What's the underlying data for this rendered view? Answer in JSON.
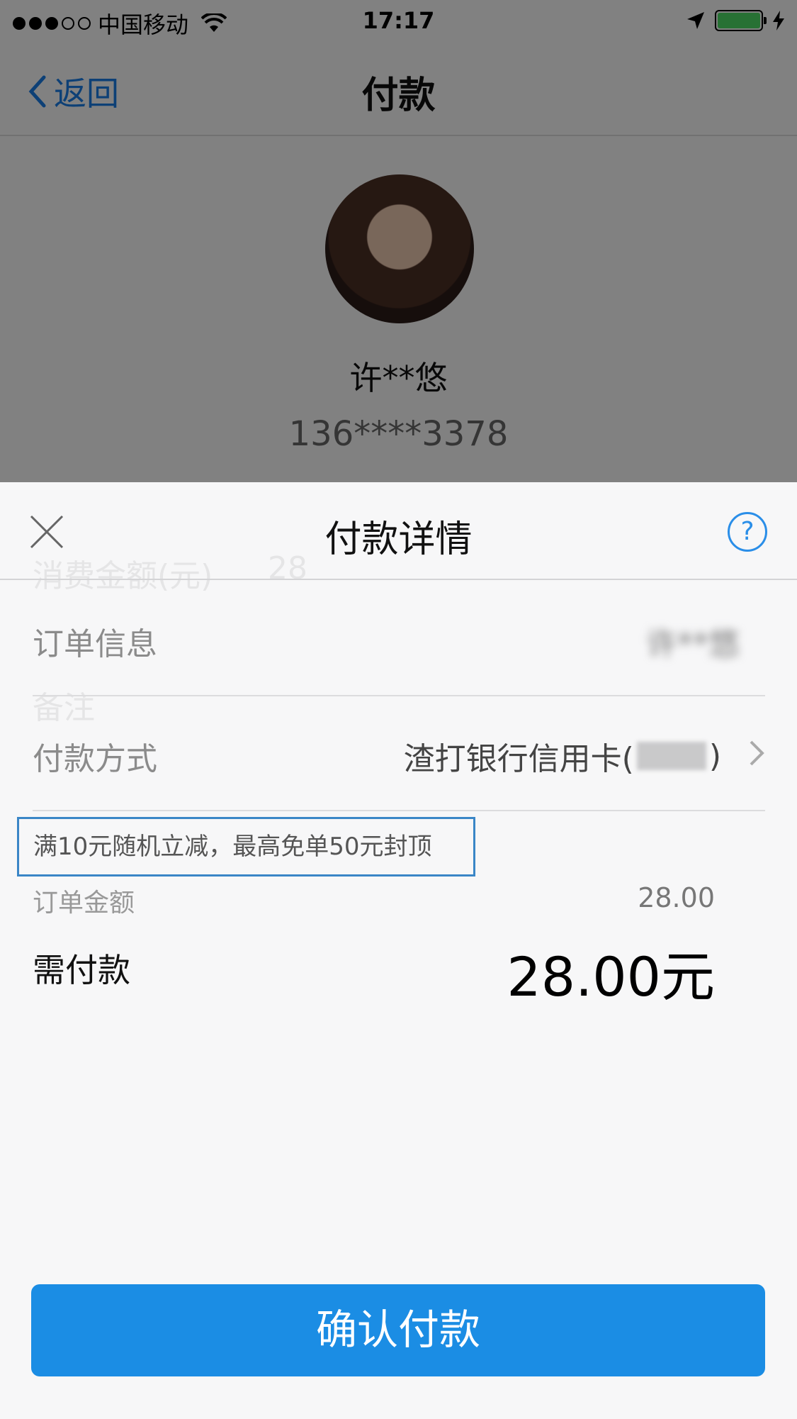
{
  "status_bar": {
    "carrier": "中国移动",
    "time": "17:17"
  },
  "navbar": {
    "back_label": "返回",
    "title": "付款"
  },
  "payee": {
    "name": "许**悠",
    "phone": "136****3378"
  },
  "background_ghost": {
    "amount_label": "消费金额(元)",
    "amount_value": "28",
    "note_label": "备注"
  },
  "sheet": {
    "title": "付款详情",
    "help_symbol": "?",
    "order_info_label": "订单信息",
    "order_info_value": "许**悠",
    "payment_method_label": "付款方式",
    "payment_method_value_prefix": "渣打银行信用卡(",
    "payment_method_value_suffix": ")",
    "promo_text": "满10元随机立减，最高免单50元封顶",
    "order_amount_label": "订单金额",
    "order_amount_value": "28.00",
    "need_pay_label": "需付款",
    "need_pay_value": "28.00元",
    "confirm_label": "确认付款"
  },
  "colors": {
    "accent": "#1b8de4",
    "battery": "#4cd964",
    "promo_border": "#3a86c7"
  },
  "icons": [
    "signal-icon",
    "wifi-icon",
    "location-arrow-icon",
    "battery-icon",
    "charging-bolt-icon",
    "chevron-left-icon",
    "close-icon",
    "help-icon",
    "chevron-right-icon"
  ]
}
